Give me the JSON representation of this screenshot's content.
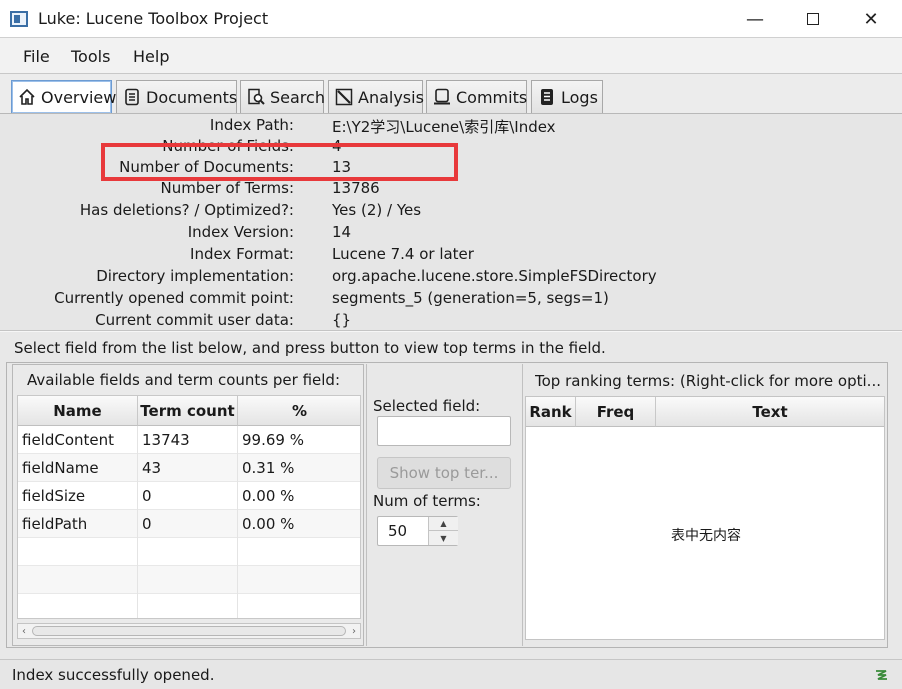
{
  "window": {
    "title": "Luke: Lucene Toolbox Project",
    "minimize": "—",
    "close": "✕"
  },
  "menu": [
    "File",
    "Tools",
    "Help"
  ],
  "tabs": [
    "Overview",
    "Documents",
    "Search",
    "Analysis",
    "Commits",
    "Logs"
  ],
  "overview": {
    "rows": [
      {
        "label": "Index Path:",
        "value": "E:\\Y2学习\\Lucene\\索引库\\Index"
      },
      {
        "label": "Number of Fields:",
        "value": "4"
      },
      {
        "label": "Number of Documents:",
        "value": "13"
      },
      {
        "label": "Number of Terms:",
        "value": "13786"
      },
      {
        "label": "Has deletions? / Optimized?:",
        "value": "Yes (2) / Yes"
      },
      {
        "label": "Index Version:",
        "value": "14"
      },
      {
        "label": "Index Format:",
        "value": "Lucene 7.4 or later"
      },
      {
        "label": "Directory implementation:",
        "value": "org.apache.lucene.store.SimpleFSDirectory"
      },
      {
        "label": "Currently opened commit point:",
        "value": "segments_5 (generation=5, segs=1)"
      },
      {
        "label": "Current commit user data:",
        "value": "{}"
      }
    ],
    "highlight_color": "#e8393b"
  },
  "instruction": "Select field from the list below, and press button to view top terms in the field.",
  "fields_panel": {
    "title": "Available fields and term counts per field:",
    "columns": [
      "Name",
      "Term count",
      "%"
    ],
    "rows": [
      [
        "fieldContent",
        "13743",
        "99.69 %"
      ],
      [
        "fieldName",
        "43",
        "0.31 %"
      ],
      [
        "fieldSize",
        "0",
        "0.00 %"
      ],
      [
        "fieldPath",
        "0",
        "0.00 %"
      ]
    ]
  },
  "controls": {
    "selected_field_label": "Selected field:",
    "selected_field_value": "",
    "show_button": "Show top ter...",
    "num_terms_label": "Num of terms:",
    "num_terms_value": "50"
  },
  "top_terms": {
    "title": "Top ranking terms: (Right-click for more opti...",
    "columns": [
      "Rank",
      "Freq",
      "Text"
    ],
    "empty_message": "表中无内容"
  },
  "status": {
    "text": "Index successfully opened."
  }
}
